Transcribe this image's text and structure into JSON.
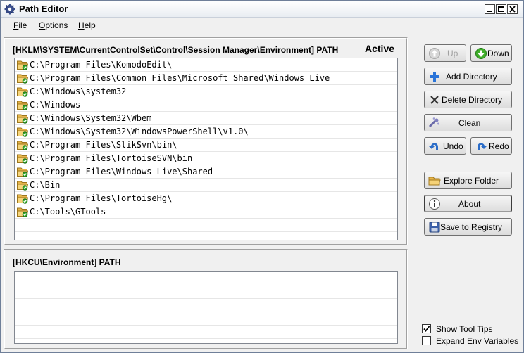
{
  "window": {
    "title": "Path Editor"
  },
  "menu": {
    "file": "File",
    "options": "Options",
    "help": "Help",
    "file_u": "F",
    "file_rest": "ile",
    "options_u": "O",
    "options_rest": "ptions",
    "help_u": "H",
    "help_rest": "elp"
  },
  "system_panel": {
    "header": "[HKLM\\SYSTEM\\CurrentControlSet\\Control\\Session Manager\\Environment] PATH",
    "active": "Active",
    "paths": [
      "C:\\Program Files\\KomodoEdit\\",
      "C:\\Program Files\\Common Files\\Microsoft Shared\\Windows Live",
      "C:\\Windows\\system32",
      "C:\\Windows",
      "C:\\Windows\\System32\\Wbem",
      "C:\\Windows\\System32\\WindowsPowerShell\\v1.0\\",
      "C:\\Program Files\\SlikSvn\\bin\\",
      "C:\\Program Files\\TortoiseSVN\\bin",
      "C:\\Program Files\\Windows Live\\Shared",
      "C:\\Bin",
      "C:\\Program Files\\TortoiseHg\\",
      "C:\\Tools\\GTools"
    ]
  },
  "user_panel": {
    "header": "[HKCU\\Environment] PATH",
    "paths": []
  },
  "buttons": {
    "up": "Up",
    "down": "Down",
    "add_directory": "Add Directory",
    "delete_directory": "Delete Directory",
    "clean": "Clean",
    "undo": "Undo",
    "redo": "Redo",
    "explore_folder": "Explore Folder",
    "about": "About",
    "save_to_registry": "Save to Registry"
  },
  "options": {
    "show_tool_tips": {
      "label": "Show Tool Tips",
      "checked": true
    },
    "expand_env_variables": {
      "label": "Expand Env Variables",
      "checked": false
    }
  }
}
